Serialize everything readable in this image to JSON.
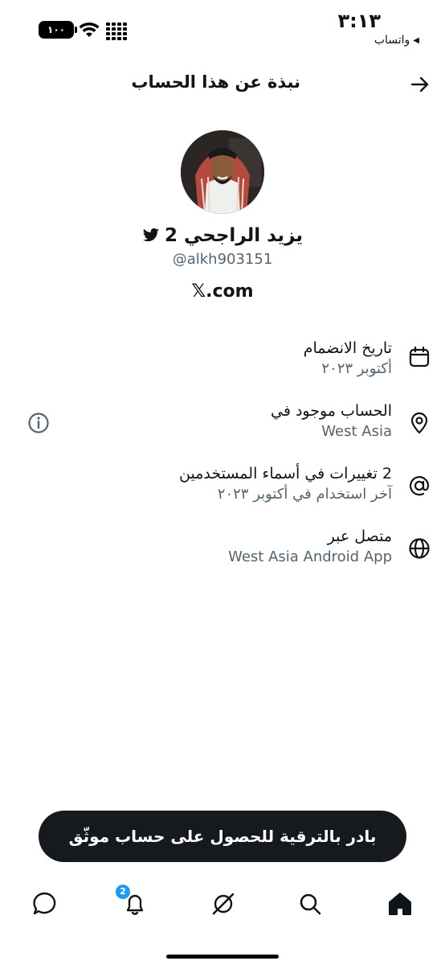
{
  "status_bar": {
    "time": "٣:١٣",
    "back_app": "واتساب",
    "battery": "١٠٠"
  },
  "header": {
    "title": "نبذة عن هذا الحساب"
  },
  "profile": {
    "name": "يزيد الراجحي 2",
    "handle": "@alkh903151",
    "platform": "𝕏.com"
  },
  "info": [
    {
      "icon": "calendar-icon",
      "title": "تاريخ الانضمام",
      "subtitle": "أكتوبر ٢٠٢٣"
    },
    {
      "icon": "location-pin-icon",
      "title": "الحساب موجود في",
      "subtitle": "West Asia"
    },
    {
      "icon": "at-sign-icon",
      "title": "2 تغييرات في أسماء المستخدمين",
      "subtitle": "آخر استخدام في أكتوبر ٢٠٢٣"
    },
    {
      "icon": "globe-icon",
      "title": "متصل عبر",
      "subtitle": "West Asia Android App"
    }
  ],
  "upgrade": {
    "label": "بادر بالترقية للحصول على حساب موثّق"
  },
  "nav": {
    "notifications_badge": "2"
  },
  "colors": {
    "primary_text": "#0f1419",
    "secondary_text": "#536471",
    "accent": "#1d9bf0",
    "pill_bg": "#161a1e"
  }
}
